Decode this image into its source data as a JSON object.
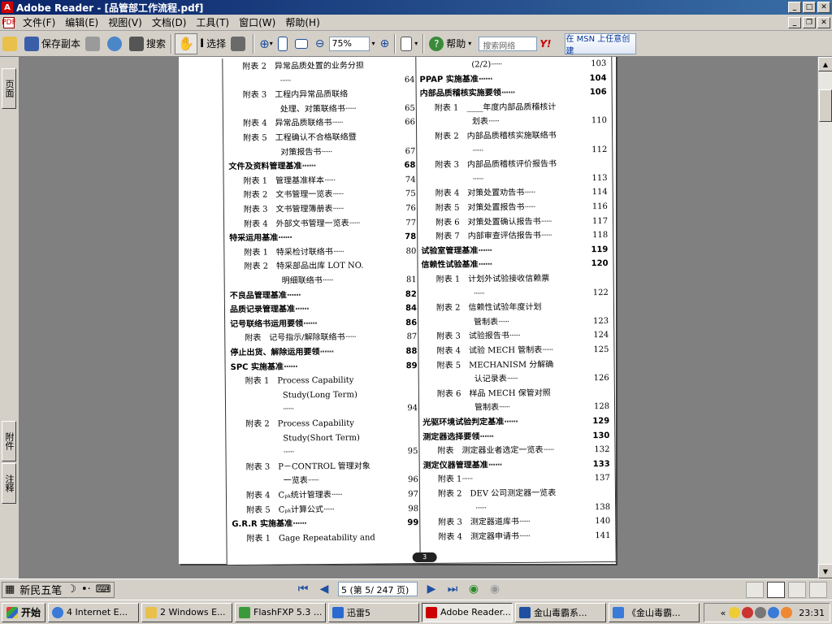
{
  "window": {
    "title": "Adobe Reader - [品管部工作流程.pdf]"
  },
  "menu": [
    "文件(F)",
    "编辑(E)",
    "视图(V)",
    "文档(D)",
    "工具(T)",
    "窗口(W)",
    "帮助(H)"
  ],
  "toolbar": {
    "save_copy": "保存副本",
    "search": "搜索",
    "select": "选择",
    "zoom": "75%",
    "help": "帮助",
    "search_web_placeholder": "搜索网络",
    "msn": "在 MSN 上任意创建"
  },
  "side_tabs": {
    "pages": "页面",
    "attachments": "附件",
    "comments": "注释"
  },
  "document": {
    "page_marker": "3",
    "left_column": [
      {
        "text": "附表 2　异常品质处置的业务分担",
        "page": "",
        "type": "sub"
      },
      {
        "text": "",
        "page": "64",
        "type": "cont"
      },
      {
        "text": "附表 3　工程内异常品质联络",
        "page": "",
        "type": "sub"
      },
      {
        "text": "处理、对策联络书",
        "page": "65",
        "type": "cont"
      },
      {
        "text": "附表 4　异常品质联络书",
        "page": "66",
        "type": "sub"
      },
      {
        "text": "附表 5　工程确认不合格联络暨",
        "page": "",
        "type": "sub"
      },
      {
        "text": "对策报告书",
        "page": "67",
        "type": "cont"
      },
      {
        "text": "文件及资料管理基准",
        "page": "68",
        "type": "h"
      },
      {
        "text": "附表 1　管理基准样本",
        "page": "74",
        "type": "sub"
      },
      {
        "text": "附表 2　文书管理一览表",
        "page": "75",
        "type": "sub"
      },
      {
        "text": "附表 3　文书管理簿册表",
        "page": "76",
        "type": "sub"
      },
      {
        "text": "附表 4　外部文书管理一览表",
        "page": "77",
        "type": "sub"
      },
      {
        "text": "特采运用基准",
        "page": "78",
        "type": "h"
      },
      {
        "text": "附表 1　特采检讨联络书",
        "page": "80",
        "type": "sub"
      },
      {
        "text": "附表 2　特采部品出库 LOT NO.",
        "page": "",
        "type": "sub"
      },
      {
        "text": "明细联络书",
        "page": "81",
        "type": "cont"
      },
      {
        "text": "不良品管理基准",
        "page": "82",
        "type": "h"
      },
      {
        "text": "品质记录管理基准",
        "page": "84",
        "type": "h"
      },
      {
        "text": "记号联络书运用要领",
        "page": "86",
        "type": "h"
      },
      {
        "text": "附表　记号指示/解除联络书",
        "page": "87",
        "type": "sub"
      },
      {
        "text": "停止出货、解除运用要领",
        "page": "88",
        "type": "h"
      },
      {
        "text": "SPC 实施基准",
        "page": "89",
        "type": "h"
      },
      {
        "text": "附表 1　Process Capability",
        "page": "",
        "type": "sub"
      },
      {
        "text": "Study(Long Term)",
        "page": "",
        "type": "cont"
      },
      {
        "text": "",
        "page": "94",
        "type": "cont"
      },
      {
        "text": "附表 2　Process Capability",
        "page": "",
        "type": "sub"
      },
      {
        "text": "Study(Short Term)",
        "page": "",
        "type": "cont"
      },
      {
        "text": "",
        "page": "95",
        "type": "cont"
      },
      {
        "text": "附表 3　P－CONTROL 管理对象",
        "page": "",
        "type": "sub"
      },
      {
        "text": "一览表",
        "page": "96",
        "type": "cont"
      },
      {
        "text": "附表 4　Cₚₖ统计管理表",
        "page": "97",
        "type": "sub"
      },
      {
        "text": "附表 5　Cₚₖ计算公式",
        "page": "98",
        "type": "sub"
      },
      {
        "text": "G.R.R 实施基准",
        "page": "99",
        "type": "h"
      },
      {
        "text": "附表 1　Gage Repeatability and",
        "page": "",
        "type": "sub"
      }
    ],
    "right_column": [
      {
        "text": "(2/2)",
        "page": "103",
        "type": "cont"
      },
      {
        "text": "PPAP 实施基准",
        "page": "104",
        "type": "h"
      },
      {
        "text": "内部品质稽核实施要领",
        "page": "106",
        "type": "h"
      },
      {
        "text": "附表 1　____年度内部品质稽核计",
        "page": "",
        "type": "sub"
      },
      {
        "text": "划表",
        "page": "110",
        "type": "cont"
      },
      {
        "text": "附表 2　内部品质稽核实施联络书",
        "page": "",
        "type": "sub"
      },
      {
        "text": "",
        "page": "112",
        "type": "cont"
      },
      {
        "text": "附表 3　内部品质稽核评价报告书",
        "page": "",
        "type": "sub"
      },
      {
        "text": "",
        "page": "113",
        "type": "cont"
      },
      {
        "text": "附表 4　对策处置劝告书",
        "page": "114",
        "type": "sub"
      },
      {
        "text": "附表 5　对策处置报告书",
        "page": "116",
        "type": "sub"
      },
      {
        "text": "附表 6　对策处置确认报告书",
        "page": "117",
        "type": "sub"
      },
      {
        "text": "附表 7　内部审查评估报告书",
        "page": "118",
        "type": "sub"
      },
      {
        "text": "试验室管理基准",
        "page": "119",
        "type": "h"
      },
      {
        "text": "信赖性试验基准",
        "page": "120",
        "type": "h"
      },
      {
        "text": "附表 1　计划外试验接收信赖票",
        "page": "",
        "type": "sub"
      },
      {
        "text": "",
        "page": "122",
        "type": "cont"
      },
      {
        "text": "附表 2　信赖性试验年度计划",
        "page": "",
        "type": "sub"
      },
      {
        "text": "管制表",
        "page": "123",
        "type": "cont"
      },
      {
        "text": "附表 3　试验报告书",
        "page": "124",
        "type": "sub"
      },
      {
        "text": "附表 4　试验 MECH 管制表",
        "page": "125",
        "type": "sub"
      },
      {
        "text": "附表 5　MECHANISM 分解确",
        "page": "",
        "type": "sub"
      },
      {
        "text": "认记录表",
        "page": "126",
        "type": "cont"
      },
      {
        "text": "附表 6　样品 MECH 保管对照",
        "page": "",
        "type": "sub"
      },
      {
        "text": "管制表",
        "page": "128",
        "type": "cont"
      },
      {
        "text": "光驱环境试验判定基准",
        "page": "129",
        "type": "h"
      },
      {
        "text": "测定器选择要领",
        "page": "130",
        "type": "h"
      },
      {
        "text": "附表　测定器业者选定一览表",
        "page": "132",
        "type": "sub"
      },
      {
        "text": "测定仪器管理基准",
        "page": "133",
        "type": "h"
      },
      {
        "text": "附表 1",
        "page": "137",
        "type": "sub"
      },
      {
        "text": "附表 2　DEV 公司测定器一览表",
        "page": "",
        "type": "sub"
      },
      {
        "text": "",
        "page": "138",
        "type": "cont"
      },
      {
        "text": "附表 3　测定器道库书",
        "page": "140",
        "type": "sub"
      },
      {
        "text": "附表 4　测定器申请书",
        "page": "141",
        "type": "sub"
      }
    ]
  },
  "ime": {
    "name": "新民五笔"
  },
  "nav": {
    "page_field": "5 (第 5/ 247 页)"
  },
  "taskbar": {
    "start": "开始",
    "tasks": [
      "4 Internet E...",
      "2 Windows E...",
      "FlashFXP 5.3 ...",
      "迅雷5",
      "Adobe Reader...",
      "金山毒霸系...",
      "《金山毒霸..."
    ],
    "clock": "23:31"
  },
  "colors": {
    "title_start": "#0a246a",
    "title_end": "#3a6ea5",
    "face": "#d4d0c8"
  }
}
